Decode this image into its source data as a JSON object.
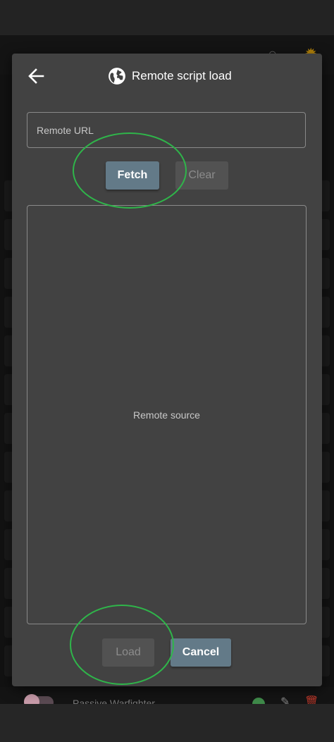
{
  "dialog": {
    "title": "Remote script load",
    "back_icon": "arrow-left-icon",
    "title_icon": "globe-icon",
    "url_field": {
      "placeholder": "Remote URL",
      "value": ""
    },
    "fetch_label": "Fetch",
    "clear_label": "Clear",
    "source_placeholder": "Remote source",
    "load_label": "Load",
    "cancel_label": "Cancel"
  },
  "background": {
    "script_item_label": "Passive Warfighter"
  },
  "colors": {
    "dialog_bg": "#424242",
    "primary_button": "#637a88",
    "disabled_button": "#525252",
    "annotation": "#2fb54a"
  }
}
